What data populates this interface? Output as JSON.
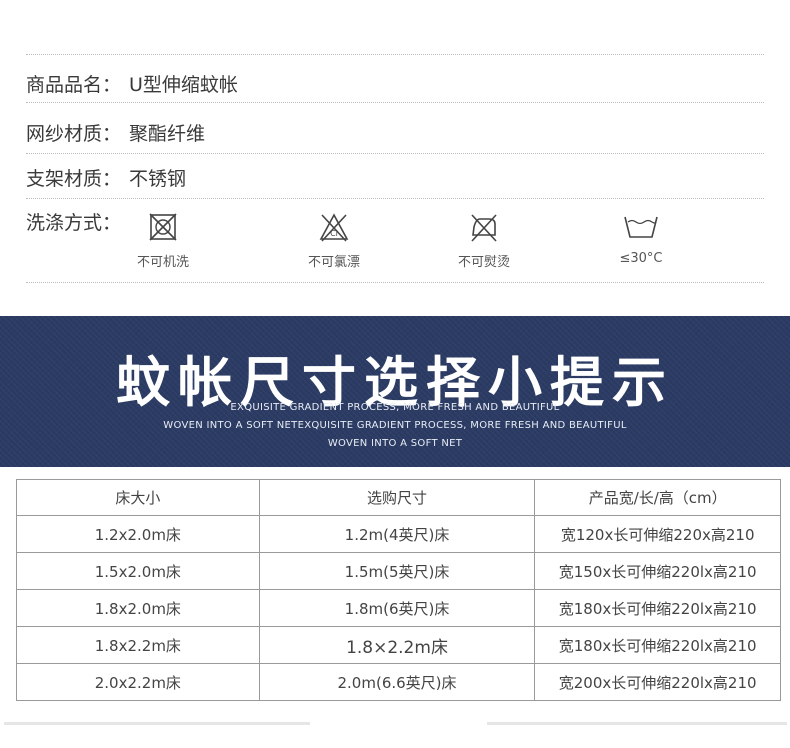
{
  "specs": [
    {
      "label": "商品品名：",
      "value": "U型伸缩蚊帐"
    },
    {
      "label": "网纱材质：",
      "value": "聚酯纤维"
    },
    {
      "label": "支架材质：",
      "value": "不锈钢"
    }
  ],
  "wash": {
    "label": "洗涤方式：",
    "items": [
      {
        "icon": "no-machine-wash-icon",
        "caption": "不可机洗"
      },
      {
        "icon": "no-bleach-icon",
        "caption": "不可氯漂"
      },
      {
        "icon": "no-iron-icon",
        "caption": "不可熨烫"
      },
      {
        "icon": "wash-30-icon",
        "caption": "≤30°C"
      }
    ]
  },
  "banner": {
    "title": "蚊帐尺寸选择小提示",
    "line1": "EXQUISITE GRADIENT PROCESS, MORE FRESH AND BEAUTIFUL",
    "line2": "WOVEN INTO A SOFT NETEXQUISITE GRADIENT PROCESS, MORE FRESH AND BEAUTIFUL",
    "line3": "WOVEN INTO A SOFT NET",
    "color": "#2b3b64"
  },
  "table": {
    "headers": [
      "床大小",
      "选购尺寸",
      "产品宽/长/高（cm）"
    ],
    "rows": [
      [
        "1.2x2.0m床",
        "1.2m(4英尺)床",
        "宽120x长可伸缩220x高210"
      ],
      [
        "1.5x2.0m床",
        "1.5m(5英尺)床",
        "宽150x长可伸缩220lx高210"
      ],
      [
        "1.8x2.0m床",
        "1.8m(6英尺)床",
        "宽180x长可伸缩220lx高210"
      ],
      [
        "1.8x2.2m床",
        "1.8×2.2m床",
        "宽180x长可伸缩220lx高210"
      ],
      [
        "2.0x2.2m床",
        "2.0m(6.6英尺)床",
        "宽200x长可伸缩220lx高210"
      ]
    ]
  }
}
